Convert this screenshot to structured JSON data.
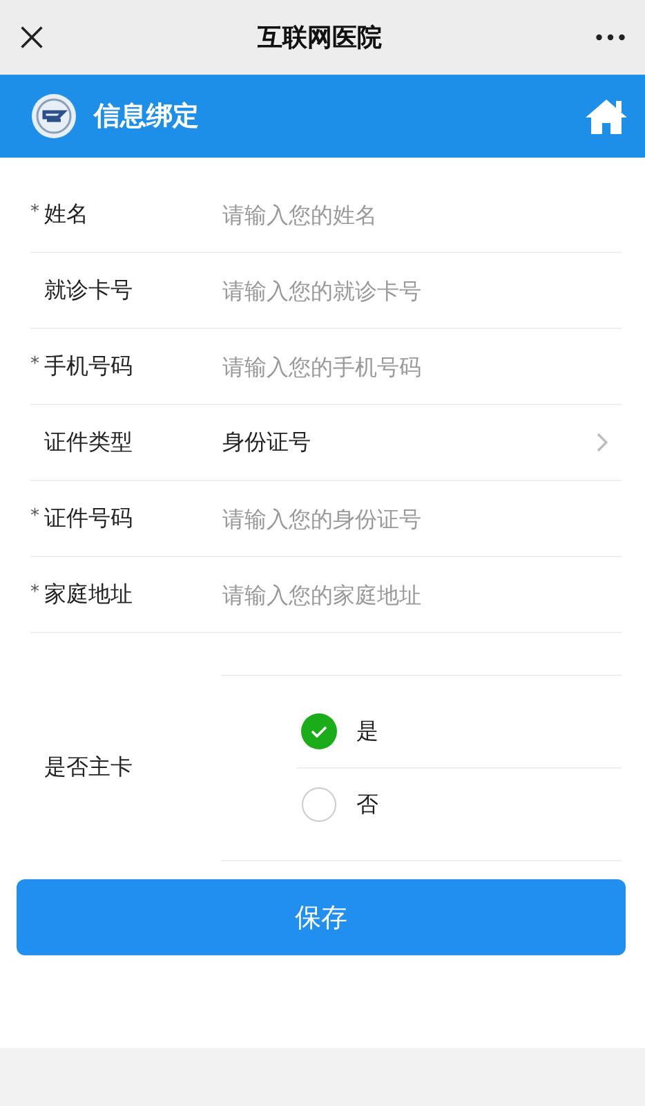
{
  "window": {
    "title": "互联网医院"
  },
  "header": {
    "title": "信息绑定"
  },
  "fields": [
    {
      "kind": "input",
      "required_mark": "*",
      "label": "姓名",
      "placeholder": "请输入您的姓名"
    },
    {
      "kind": "input",
      "label": "就诊卡号",
      "placeholder": "请输入您的就诊卡号"
    },
    {
      "kind": "input",
      "required_mark": "*",
      "label": "手机号码",
      "placeholder": "请输入您的手机号码"
    },
    {
      "kind": "select",
      "label": "证件类型",
      "value": "身份证号"
    },
    {
      "kind": "input",
      "required_mark": "*",
      "label": "证件号码",
      "placeholder": "请输入您的身份证号"
    },
    {
      "kind": "input",
      "required_mark": "*",
      "label": "家庭地址",
      "placeholder": "请输入您的家庭地址"
    }
  ],
  "main_card": {
    "label": "是否主卡",
    "options": [
      {
        "label": "是",
        "selected": true
      },
      {
        "label": "否",
        "selected": false
      }
    ]
  },
  "save_button": "保存"
}
